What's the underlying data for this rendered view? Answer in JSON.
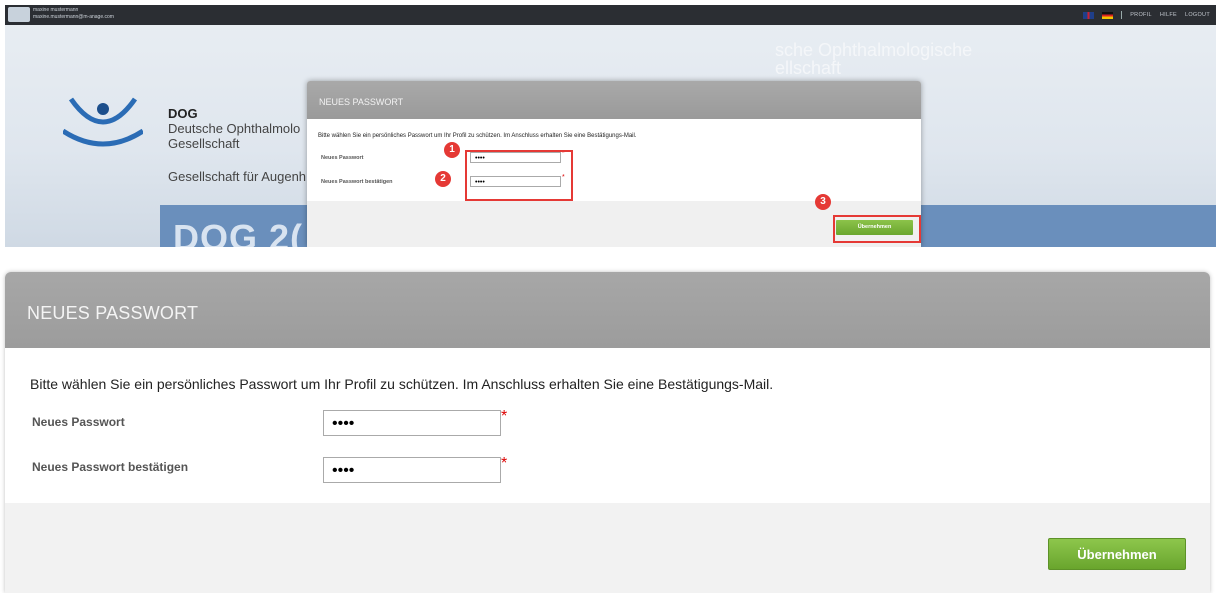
{
  "topbar": {
    "user_name": "maxine mustermann",
    "user_email": "maxine.mustermann@m-anage.com",
    "links": [
      "PROFIL",
      "HILFE",
      "LOGOUT"
    ],
    "flags": [
      "flag-uk-icon",
      "flag-de-icon"
    ]
  },
  "background": {
    "org_short": "DOG",
    "org_line1": "Deutsche Ophthalmolo",
    "org_line2": "Gesellschaft",
    "org_line3": "Gesellschaft für Augenh",
    "bg_text1": "sche Ophthalmologische",
    "bg_text2": "ellschaft",
    "banner_text": "DOG 2("
  },
  "modal": {
    "title": "NEUES PASSWORT",
    "message": "Bitte wählen Sie ein persönliches Passwort um Ihr Profil zu schützen. Im Anschluss erhalten Sie eine Bestätigungs-Mail.",
    "field1_label": "Neues Passwort",
    "field1_value": "••••",
    "field2_label": "Neues Passwort bestätigen",
    "field2_value": "••••",
    "required_mark": "*",
    "submit_label": "Übernehmen"
  },
  "annotations": [
    "1",
    "2",
    "3"
  ],
  "colors": {
    "accent_green": "#7ab83c",
    "header_gray": "#a3a3a3",
    "highlight_red": "#e53935",
    "topbar": "#2b2e33"
  }
}
